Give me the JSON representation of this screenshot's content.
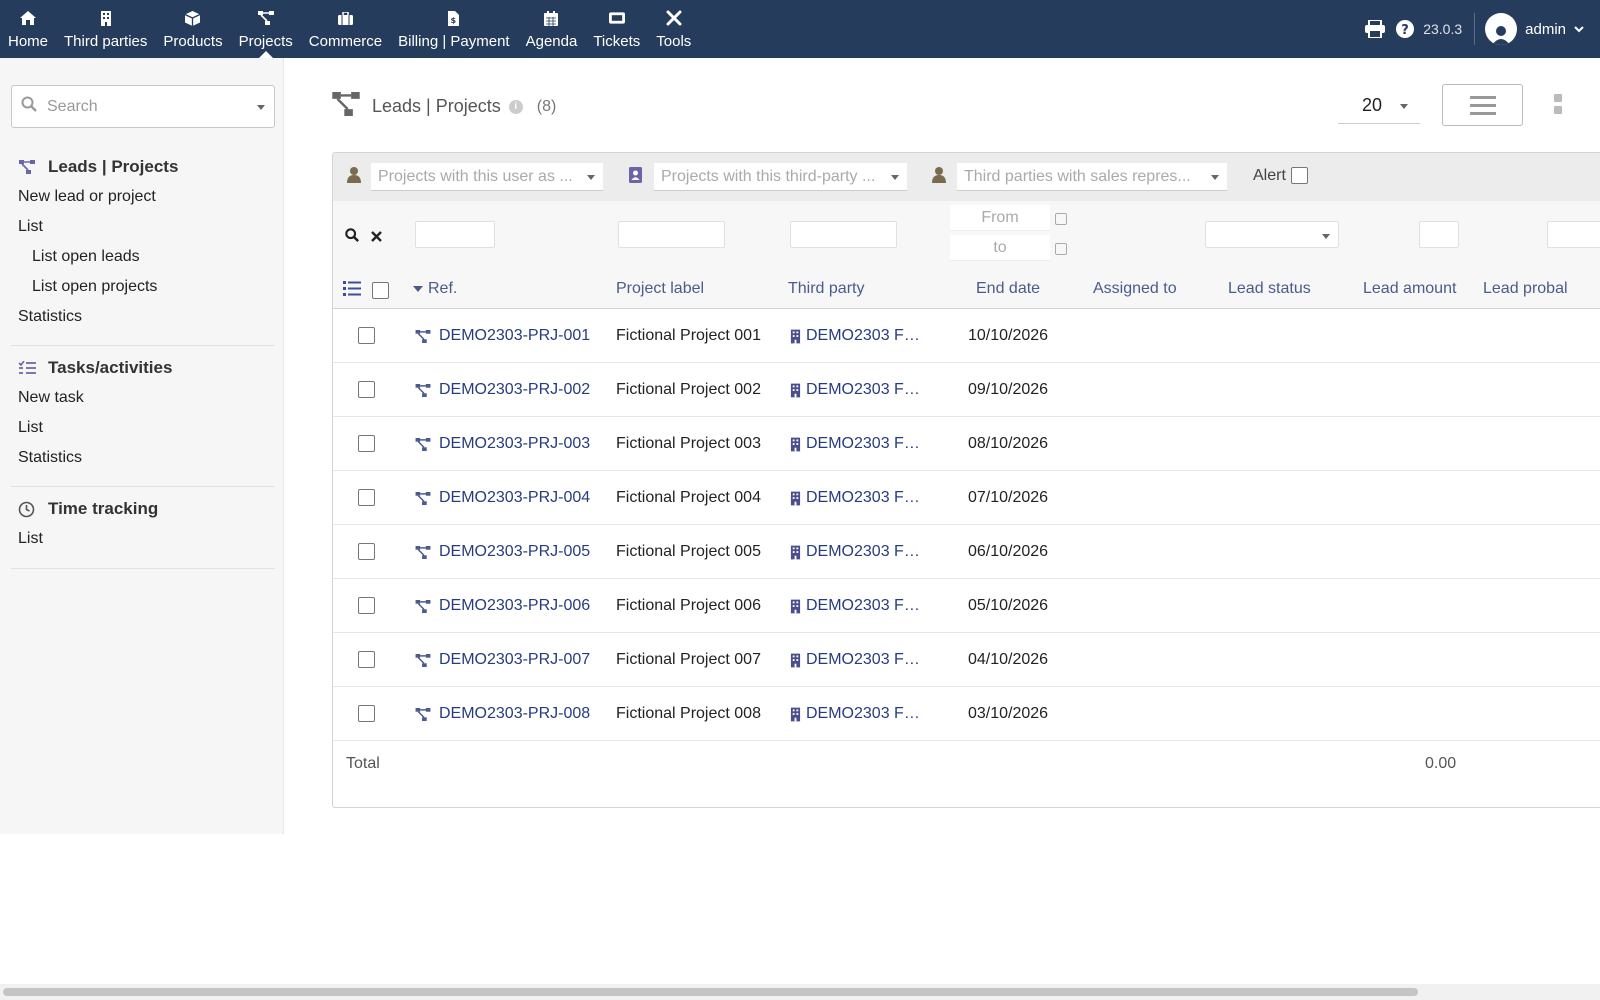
{
  "topmenu": [
    {
      "label": "Home",
      "icon": "home-icon"
    },
    {
      "label": "Third parties",
      "icon": "building-icon"
    },
    {
      "label": "Products",
      "icon": "cube-icon"
    },
    {
      "label": "Projects",
      "icon": "sitemap-icon"
    },
    {
      "label": "Commerce",
      "icon": "suitcase-icon"
    },
    {
      "label": "Billing | Payment",
      "icon": "invoice-icon"
    },
    {
      "label": "Agenda",
      "icon": "calendar-icon"
    },
    {
      "label": "Tickets",
      "icon": "ticket-icon"
    },
    {
      "label": "Tools",
      "icon": "tools-icon"
    }
  ],
  "topright": {
    "version": "23.0.3",
    "username": "admin"
  },
  "sidebar": {
    "search_placeholder": "Search",
    "projects": {
      "title": "Leads | Projects",
      "items": [
        "New lead or project",
        "List",
        "List open leads",
        "List open projects",
        "Statistics"
      ]
    },
    "tasks": {
      "title": "Tasks/activities",
      "items": [
        "New task",
        "List",
        "Statistics"
      ]
    },
    "time": {
      "title": "Time tracking",
      "items": [
        "List"
      ]
    }
  },
  "page": {
    "title": "Leads | Projects",
    "count": "(8)",
    "limit": "20"
  },
  "filters": {
    "user_role": "Projects with this user as ...",
    "thirdparty_contact": "Projects with this third-party ...",
    "sales_rep": "Third parties with sales repres...",
    "alert_label": "Alert",
    "date_from": "From",
    "date_to": "to"
  },
  "columns": {
    "ref": "Ref.",
    "label": "Project label",
    "thirdparty": "Third party",
    "end_date": "End date",
    "assigned": "Assigned to",
    "lead_status": "Lead status",
    "lead_amount": "Lead amount",
    "lead_probability": "Lead probal"
  },
  "rows": [
    {
      "ref": "DEMO2303-PRJ-001",
      "label": "Fictional Project 001",
      "thirdparty": "DEMO2303 F…",
      "end_date": "10/10/2026"
    },
    {
      "ref": "DEMO2303-PRJ-002",
      "label": "Fictional Project 002",
      "thirdparty": "DEMO2303 F…",
      "end_date": "09/10/2026"
    },
    {
      "ref": "DEMO2303-PRJ-003",
      "label": "Fictional Project 003",
      "thirdparty": "DEMO2303 F…",
      "end_date": "08/10/2026"
    },
    {
      "ref": "DEMO2303-PRJ-004",
      "label": "Fictional Project 004",
      "thirdparty": "DEMO2303 F…",
      "end_date": "07/10/2026"
    },
    {
      "ref": "DEMO2303-PRJ-005",
      "label": "Fictional Project 005",
      "thirdparty": "DEMO2303 F…",
      "end_date": "06/10/2026"
    },
    {
      "ref": "DEMO2303-PRJ-006",
      "label": "Fictional Project 006",
      "thirdparty": "DEMO2303 F…",
      "end_date": "05/10/2026"
    },
    {
      "ref": "DEMO2303-PRJ-007",
      "label": "Fictional Project 007",
      "thirdparty": "DEMO2303 F…",
      "end_date": "04/10/2026"
    },
    {
      "ref": "DEMO2303-PRJ-008",
      "label": "Fictional Project 008",
      "thirdparty": "DEMO2303 F…",
      "end_date": "03/10/2026"
    }
  ],
  "total": {
    "label": "Total",
    "lead_amount": "0.00"
  },
  "colors": {
    "topbar": "#263c5c",
    "link": "#263c80",
    "column_header": "#4a5b8c",
    "icon_brown": "#7a6a4f"
  }
}
